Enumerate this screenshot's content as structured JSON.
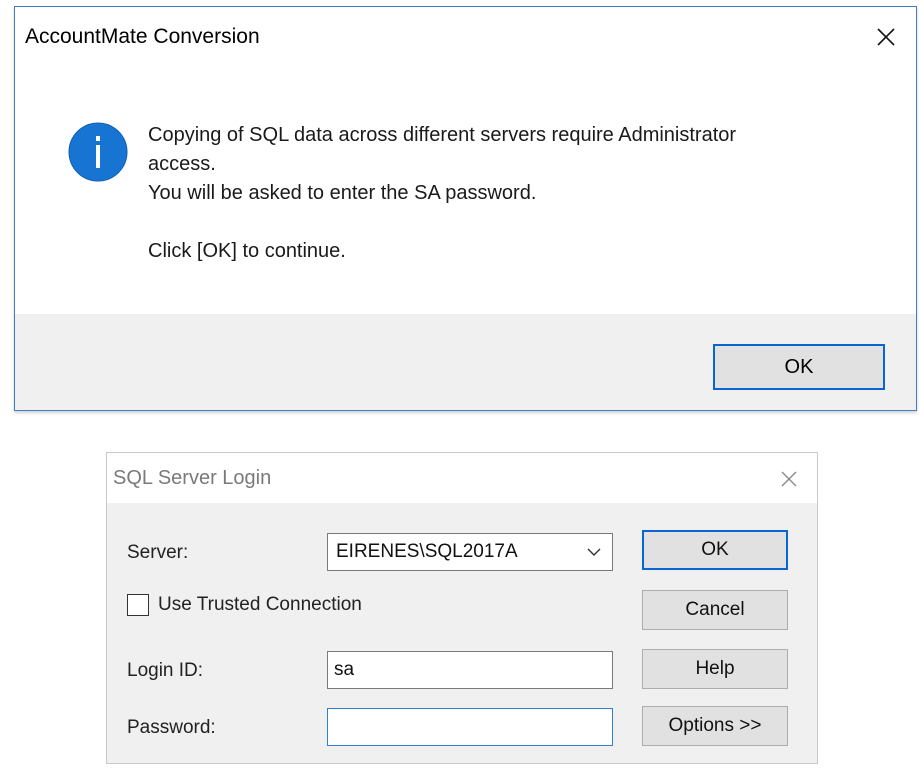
{
  "message_box": {
    "title": "AccountMate Conversion",
    "icon": "info-icon",
    "lines": [
      "Copying of SQL data across different servers require Administrator",
      "access.",
      "You will be asked to enter the SA password."
    ],
    "continue_line": "Click [OK] to continue.",
    "ok_label": "OK"
  },
  "login_dialog": {
    "title": "SQL Server Login",
    "server_label": "Server:",
    "server_value": "EIRENES\\SQL2017A",
    "trusted_label": "Use Trusted Connection",
    "trusted_checked": false,
    "login_label": "Login ID:",
    "login_value": "sa",
    "password_label": "Password:",
    "password_value": "",
    "buttons": {
      "ok": "OK",
      "cancel": "Cancel",
      "help": "Help",
      "options": "Options >>"
    }
  },
  "colors": {
    "accent": "#0a64d2",
    "info_icon": "#1874d3",
    "footer": "#f0f0f0"
  }
}
